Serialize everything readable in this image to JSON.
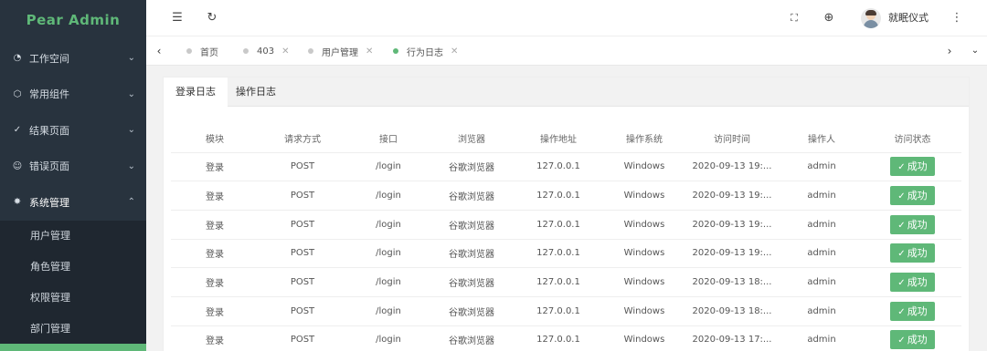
{
  "app": {
    "title": "Pear Admin"
  },
  "sidebar": {
    "menu": [
      {
        "icon": "dashboard-icon",
        "glyph": "◔",
        "label": "工作空间"
      },
      {
        "icon": "component-icon",
        "glyph": "⬡",
        "label": "常用组件"
      },
      {
        "icon": "check-circle-icon",
        "glyph": "✓",
        "label": "结果页面"
      },
      {
        "icon": "face-icon",
        "glyph": "☺",
        "label": "错误页面"
      },
      {
        "icon": "gear-icon",
        "glyph": "✸",
        "label": "系统管理"
      }
    ],
    "submenu": [
      "用户管理",
      "角色管理",
      "权限管理",
      "部门管理"
    ]
  },
  "header": {
    "username": "就眠仪式"
  },
  "tabs": [
    {
      "label": "首页",
      "closable": false
    },
    {
      "label": "403",
      "closable": true
    },
    {
      "label": "用户管理",
      "closable": true
    },
    {
      "label": "行为日志",
      "closable": true,
      "active": true
    }
  ],
  "content": {
    "tabs": [
      "登录日志",
      "操作日志"
    ],
    "table": {
      "columns": [
        "模块",
        "请求方式",
        "接口",
        "浏览器",
        "操作地址",
        "操作系统",
        "访问时间",
        "操作人",
        "访问状态"
      ],
      "rows": [
        [
          "登录",
          "POST",
          "/login",
          "谷歌浏览器",
          "127.0.0.1",
          "Windows",
          "2020-09-13 19:...",
          "admin",
          "成功"
        ],
        [
          "登录",
          "POST",
          "/login",
          "谷歌浏览器",
          "127.0.0.1",
          "Windows",
          "2020-09-13 19:...",
          "admin",
          "成功"
        ],
        [
          "登录",
          "POST",
          "/login",
          "谷歌浏览器",
          "127.0.0.1",
          "Windows",
          "2020-09-13 19:...",
          "admin",
          "成功"
        ],
        [
          "登录",
          "POST",
          "/login",
          "谷歌浏览器",
          "127.0.0.1",
          "Windows",
          "2020-09-13 19:...",
          "admin",
          "成功"
        ],
        [
          "登录",
          "POST",
          "/login",
          "谷歌浏览器",
          "127.0.0.1",
          "Windows",
          "2020-09-13 18:...",
          "admin",
          "成功"
        ],
        [
          "登录",
          "POST",
          "/login",
          "谷歌浏览器",
          "127.0.0.1",
          "Windows",
          "2020-09-13 18:...",
          "admin",
          "成功"
        ],
        [
          "登录",
          "POST",
          "/login",
          "谷歌浏览器",
          "127.0.0.1",
          "Windows",
          "2020-09-13 17:...",
          "admin",
          "成功"
        ]
      ]
    }
  },
  "colors": {
    "accent": "#5fb878",
    "sidebar": "#28333e"
  }
}
